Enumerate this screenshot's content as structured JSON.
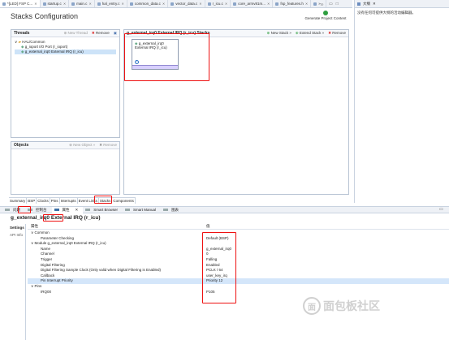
{
  "editor_tabs": [
    {
      "label": "*[LED] FSP C...",
      "active": true
    },
    {
      "label": "startup.c"
    },
    {
      "label": "main.c"
    },
    {
      "label": "hal_entry.c"
    },
    {
      "label": "common_data.c"
    },
    {
      "label": "vector_data.c"
    },
    {
      "label": "r_icu.c"
    },
    {
      "label": "core_armv81m..."
    },
    {
      "label": "fsp_features.h"
    },
    {
      "label": "»₂₀"
    }
  ],
  "outline": {
    "tab": "大纲",
    "message": "没有任何可提供大纲的活动编辑器。"
  },
  "page": {
    "title": "Stacks Configuration",
    "generate_label": "Generate Project Content"
  },
  "threads": {
    "title": "Threads",
    "new_thread": "New Thread",
    "remove": "Remove",
    "tree": {
      "root": "HAL/Common",
      "items": [
        "g_ioport I/O Port (r_ioport)",
        "g_external_irq0 External IRQ (r_icu)"
      ]
    }
  },
  "stacks": {
    "title": "g_external_irq0 External IRQ (r_icu) Stacks",
    "new_stack": "New Stack »",
    "extend_stack": "Extend Stack »",
    "remove": "Remove",
    "block_label": "g_external_irq0 External IRQ (r_icu)",
    "info_symbol": "i"
  },
  "objects": {
    "title": "Objects",
    "new_object": "New Object »",
    "remove": "Remove"
  },
  "bottom_tabs": [
    "Summary",
    "BSP",
    "Clocks",
    "Pins",
    "Interrupts",
    "Event Links",
    "Stacks",
    "Components"
  ],
  "view_tabs": [
    "问题",
    "控制台",
    "属性",
    "Smart Browser",
    "Smart Manual",
    "图表"
  ],
  "properties": {
    "title": "g_external_irq0 External IRQ (r_icu)",
    "side_tabs": [
      "Settings",
      "API Info"
    ],
    "header": {
      "property": "属性",
      "value": "值"
    },
    "rows": [
      {
        "p": "Common",
        "v": "",
        "indent": 0,
        "arrow": "∨"
      },
      {
        "p": "Parameter Checking",
        "v": "Default (BSP)",
        "indent": 2
      },
      {
        "p": "Module g_external_irq0 External IRQ (r_icu)",
        "v": "",
        "indent": 0,
        "arrow": "∨"
      },
      {
        "p": "Name",
        "v": "g_external_irq0",
        "indent": 2
      },
      {
        "p": "Channel",
        "v": "0",
        "indent": 2
      },
      {
        "p": "Trigger",
        "v": "Falling",
        "indent": 2
      },
      {
        "p": "Digital Filtering",
        "v": "Enabled",
        "indent": 2
      },
      {
        "p": "Digital Filtering Sample Clock (Only valid when Digital Filtering is Enabled)",
        "v": "PCLK / 64",
        "indent": 2
      },
      {
        "p": "Callback",
        "v": "user_key_irq",
        "indent": 2
      },
      {
        "p": "Pin Interrupt Priority",
        "v": "Priority 12",
        "indent": 2,
        "hl": true
      },
      {
        "p": "Pins",
        "v": "",
        "indent": 0,
        "arrow": "∨"
      },
      {
        "p": "IRQ00",
        "v": "P105",
        "indent": 2
      }
    ]
  },
  "watermark": {
    "symbol": "面",
    "text": "面包板社区"
  },
  "colors": {
    "accent_red": "#e11111",
    "selection": "#d4e6fa",
    "generate_green": "#2e9e3f"
  }
}
